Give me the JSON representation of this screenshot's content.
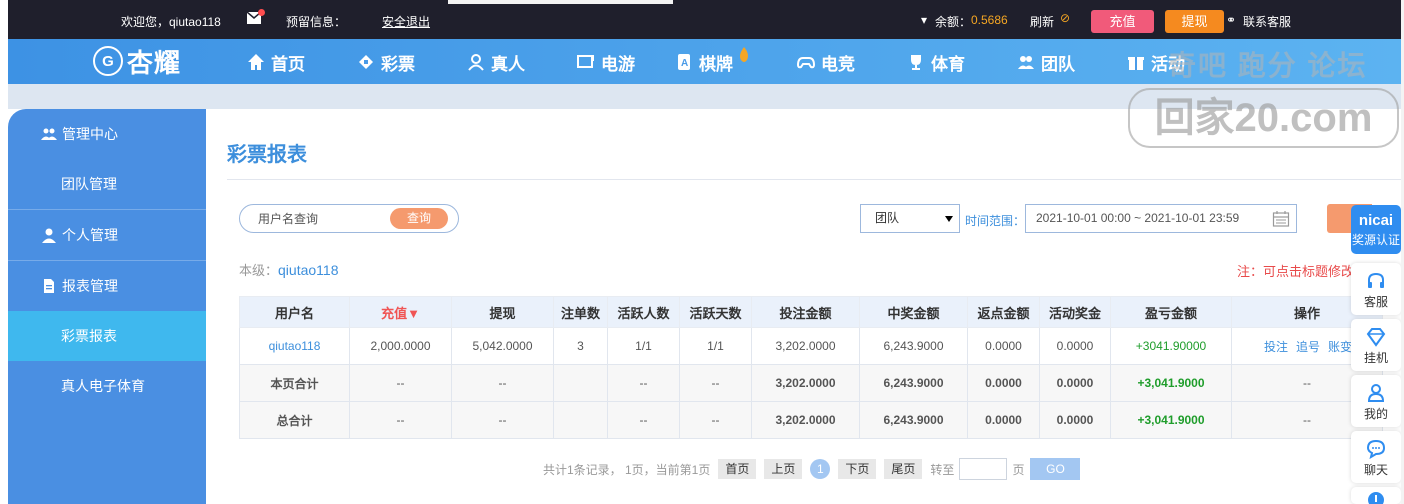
{
  "topbar": {
    "welcome": "欢迎您，qiutao118",
    "reserved_info_label": "预留信息：",
    "logout": "安全退出",
    "balance_label": "余额：",
    "balance_value": "0.5686",
    "refresh": "刷新",
    "recharge": "充值",
    "withdraw": "提现",
    "support": "联系客服"
  },
  "brand": {
    "logo_text": "杏耀",
    "logo_badge": "G"
  },
  "nav": [
    {
      "label": "首页",
      "icon": "home-icon"
    },
    {
      "label": "彩票",
      "icon": "ticket-icon"
    },
    {
      "label": "真人",
      "icon": "person-icon"
    },
    {
      "label": "电游",
      "icon": "arcade-icon"
    },
    {
      "label": "棋牌",
      "icon": "cards-icon"
    },
    {
      "label": "电竞",
      "icon": "gamepad-icon"
    },
    {
      "label": "体育",
      "icon": "trophy-icon"
    },
    {
      "label": "团队",
      "icon": "team-icon"
    },
    {
      "label": "活动",
      "icon": "gift-icon"
    }
  ],
  "watermark": {
    "top": "奇吧 跑分 论坛",
    "bottom": "回家20.com"
  },
  "sidebar": {
    "items": [
      {
        "label": "管理中心",
        "type": "group"
      },
      {
        "label": "团队管理",
        "type": "sub"
      },
      {
        "label": "个人管理",
        "type": "group"
      },
      {
        "label": "报表管理",
        "type": "group"
      },
      {
        "label": "彩票报表",
        "type": "sub",
        "active": true
      },
      {
        "label": "真人电子体育",
        "type": "sub"
      }
    ]
  },
  "page": {
    "title": "彩票报表",
    "search_placeholder": "用户名查询",
    "search_button": "查询",
    "scope_select": "团队",
    "time_label": "时间范围：",
    "date_range": "2021-10-01 00:00 ~ 2021-10-01 23:59",
    "level_label": "本级：",
    "level_user": "qiutao118",
    "note": "注：可点击标题修改"
  },
  "table": {
    "headers": [
      "用户名",
      "充值▼",
      "提现",
      "注单数",
      "活跃人数",
      "活跃天数",
      "投注金额",
      "中奖金额",
      "返点金额",
      "活动奖金",
      "盈亏金额",
      "操作"
    ],
    "rows": [
      {
        "cells": [
          "qiutao118",
          "2,000.0000",
          "5,042.0000",
          "3",
          "1/1",
          "1/1",
          "3,202.0000",
          "6,243.9000",
          "0.0000",
          "0.0000",
          "+3041.90000"
        ],
        "ops": [
          "投注",
          "追号",
          "账变"
        ]
      },
      {
        "cells": [
          "本页合计",
          "--",
          "--",
          "",
          "--",
          "--",
          "3,202.0000",
          "6,243.9000",
          "0.0000",
          "0.0000",
          "+3,041.9000"
        ],
        "ops_text": "--"
      },
      {
        "cells": [
          "总合计",
          "--",
          "--",
          "",
          "--",
          "--",
          "3,202.0000",
          "6,243.9000",
          "0.0000",
          "0.0000",
          "+3,041.9000"
        ],
        "ops_text": "--"
      }
    ]
  },
  "pager": {
    "summary": "共计1条记录， 1页，当前第1页",
    "first": "首页",
    "prev": "上页",
    "current": "1",
    "next": "下页",
    "last": "尾页",
    "goto_label": "转至",
    "page_unit": "页",
    "go": "GO"
  },
  "float": {
    "head_big": "nicai",
    "head_small": "奖源认证",
    "items": [
      {
        "label": "客服",
        "icon": "headset-icon"
      },
      {
        "label": "挂机",
        "icon": "diamond-icon"
      },
      {
        "label": "我的",
        "icon": "user-icon"
      },
      {
        "label": "聊天",
        "icon": "chat-icon"
      }
    ]
  }
}
